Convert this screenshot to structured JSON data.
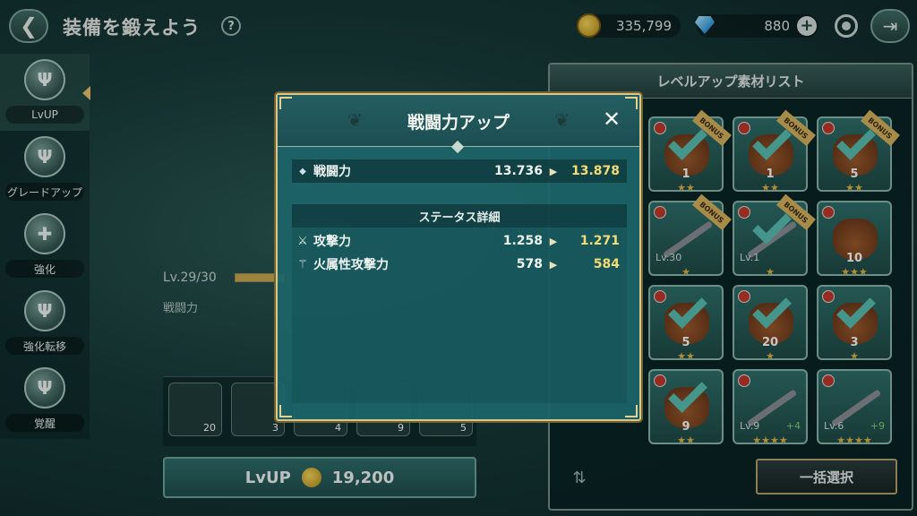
{
  "header": {
    "title": "装備を鍛えよう",
    "help": "?",
    "gold": "335,799",
    "gems": "880"
  },
  "sidebar": {
    "items": [
      {
        "label": "LvUP",
        "active": true
      },
      {
        "label": "グレードアップ"
      },
      {
        "label": "強化"
      },
      {
        "label": "強化転移"
      },
      {
        "label": "覚醒"
      }
    ]
  },
  "main": {
    "lv_label": "Lv.29/30",
    "lv_progress": 0.95,
    "power_label": "戦闘力",
    "lvup_label": "LvUP",
    "lvup_cost": "19,200",
    "materials": [
      "20",
      "3",
      "4",
      "9",
      "5"
    ]
  },
  "materials_panel": {
    "title": "レベルアップ素材リスト",
    "bulk_select": "一括選択",
    "bonus": "BONUS",
    "items": [
      {
        "count": "1",
        "stars": "★★",
        "bonus": true,
        "checked": true
      },
      {
        "count": "1",
        "stars": "★★",
        "bonus": true,
        "checked": true
      },
      {
        "count": "5",
        "stars": "★★",
        "bonus": true,
        "checked": true
      },
      {
        "level": "Lv.30",
        "stars": "★",
        "bonus": true,
        "weapon": true
      },
      {
        "level": "Lv.1",
        "stars": "★",
        "bonus": true,
        "weapon": true,
        "checked": true
      },
      {
        "count": "10",
        "stars": "★★★"
      },
      {
        "count": "5",
        "stars": "★★",
        "checked": true
      },
      {
        "count": "20",
        "stars": "★",
        "checked": true
      },
      {
        "count": "3",
        "stars": "★",
        "checked": true
      },
      {
        "count": "9",
        "stars": "★★",
        "checked": true
      },
      {
        "level": "Lv.9",
        "plus": "+4",
        "stars": "★★★★",
        "weapon": true
      },
      {
        "level": "Lv.6",
        "plus": "+9",
        "stars": "★★★★",
        "weapon": true
      }
    ]
  },
  "dialog": {
    "title": "戦闘力アップ",
    "power": {
      "name": "戦闘力",
      "old": "13.736",
      "new": "13.878"
    },
    "detail_title": "ステータス詳細",
    "stats": [
      {
        "name": "攻撃力",
        "old": "1.258",
        "new": "1.271"
      },
      {
        "name": "火属性攻撃力",
        "old": "578",
        "new": "584"
      }
    ]
  },
  "colors": {
    "accent_gold": "#f3dc75",
    "check": "#58c1b5",
    "dialog_bg": "#1c6468",
    "border_gold": "#d9c788"
  }
}
